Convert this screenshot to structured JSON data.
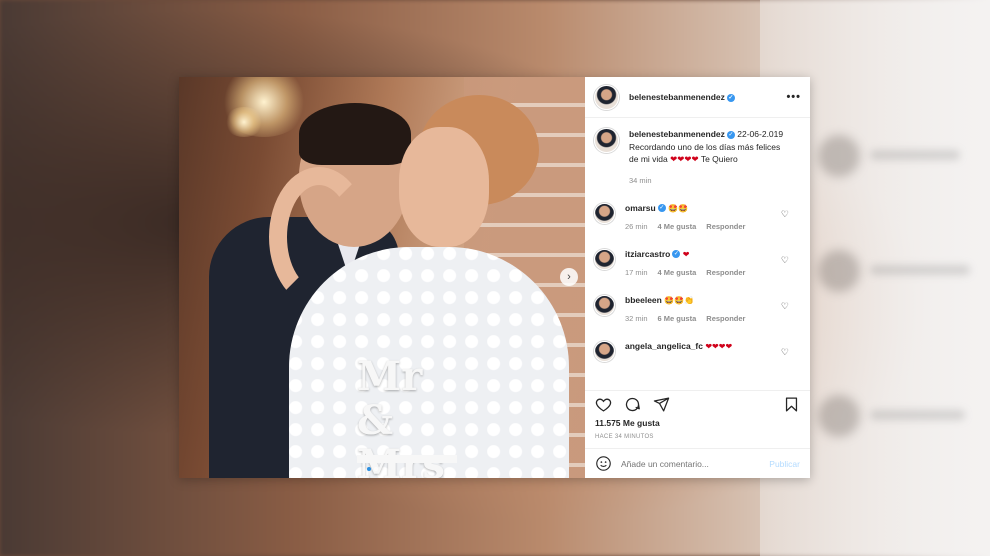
{
  "post": {
    "username": "belenestebanmenendez",
    "photo_sign": "Mr & Mrs",
    "caption_text": "22-06-2.019 Recordando uno de los días más felices de mi vida",
    "caption_trail": "Te Quiero",
    "caption_time": "34 min",
    "likes": "11.575 Me gusta",
    "ago": "HACE 34 MINUTOS",
    "comment_placeholder": "Añade un comentario...",
    "publish_label": "Publicar"
  },
  "comments": [
    {
      "user": "omarsu",
      "text": "🤩🤩",
      "time": "26 min",
      "likes": "4 Me gusta",
      "reply": "Responder"
    },
    {
      "user": "itziarcastro",
      "text": "❤",
      "time": "17 min",
      "likes": "4 Me gusta",
      "reply": "Responder"
    },
    {
      "user": "bbeeleen",
      "text": "🤩🤩👏",
      "time": "32 min",
      "likes": "6 Me gusta",
      "reply": "Responder"
    },
    {
      "user": "angela_angelica_fc",
      "text": "❤❤❤❤"
    }
  ],
  "icons": [
    "heart-icon",
    "comment-icon",
    "share-icon",
    "bookmark-icon",
    "emoji-icon",
    "more-icon",
    "verified-icon",
    "chevron-right-icon"
  ],
  "colors": {
    "link": "#3897f0",
    "heart": "#d0021b",
    "publish": "#b3dbff"
  }
}
